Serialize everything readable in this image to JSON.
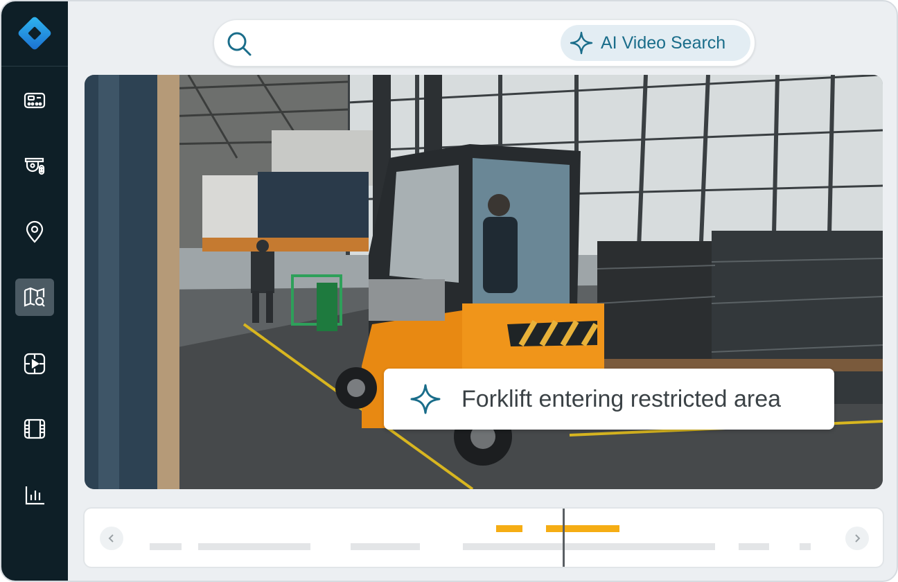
{
  "search": {
    "icon": "search-icon",
    "ai_button_label": "AI Video Search",
    "ai_button_icon": "sparkle-icon"
  },
  "sidebar": {
    "items": [
      {
        "name": "dashboard",
        "icon": "dashboard-icon",
        "active": false
      },
      {
        "name": "cameras",
        "icon": "camera-icon",
        "active": false
      },
      {
        "name": "locations",
        "icon": "location-pin-icon",
        "active": false
      },
      {
        "name": "map-search",
        "icon": "map-search-icon",
        "active": true
      },
      {
        "name": "video-wall",
        "icon": "video-play-icon",
        "active": false
      },
      {
        "name": "recordings",
        "icon": "film-icon",
        "active": false
      },
      {
        "name": "analytics",
        "icon": "bar-chart-icon",
        "active": false
      }
    ]
  },
  "video": {
    "caption": "Forklift entering restricted area",
    "caption_icon": "sparkle-icon"
  },
  "timeline": {
    "prev_icon": "chevron-left-icon",
    "next_icon": "chevron-right-icon"
  },
  "colors": {
    "sidebar_bg": "#0e1f27",
    "accent": "#1a6d8a",
    "highlight": "#f5ad14"
  }
}
